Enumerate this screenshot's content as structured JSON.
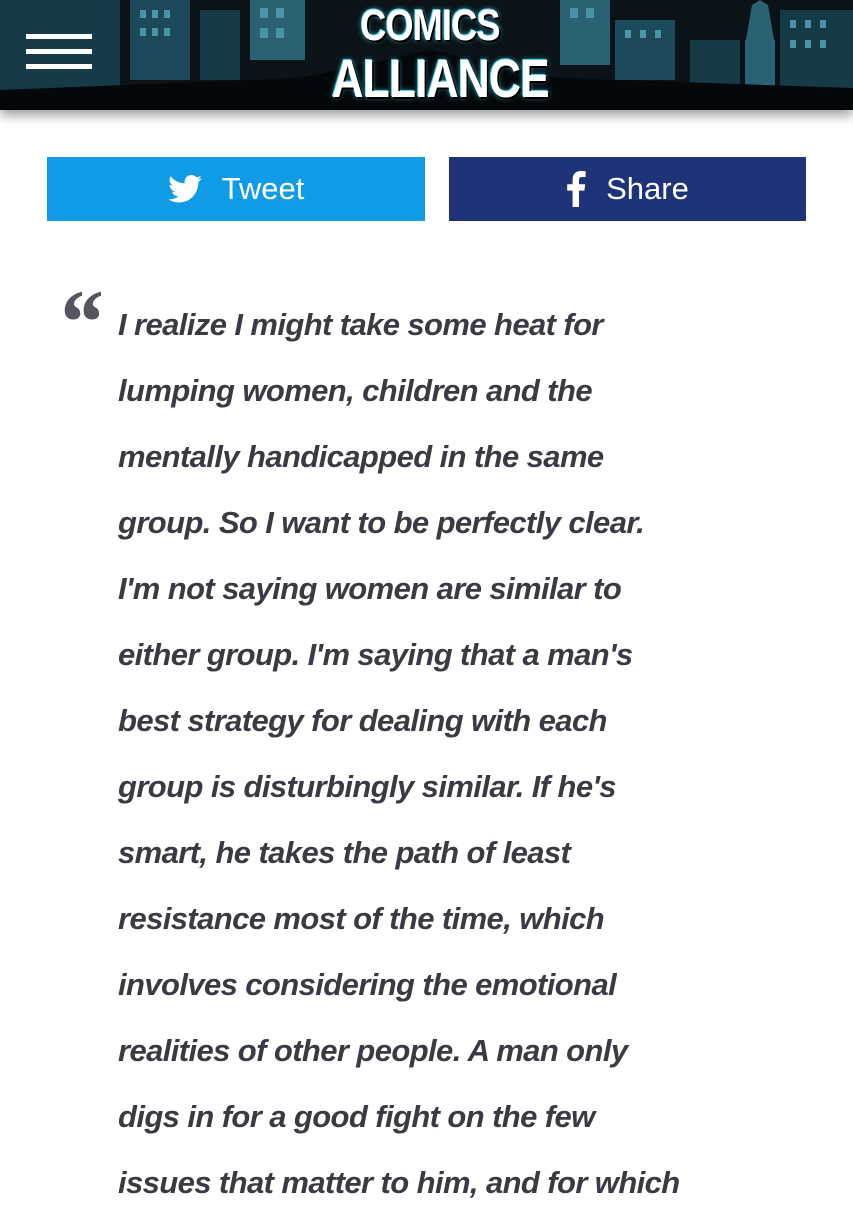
{
  "header": {
    "menu_icon": "hamburger-menu-icon",
    "logo": {
      "line1": "COMICS",
      "line2": "ALLIANCE"
    },
    "colors": {
      "background": "#0b1218",
      "skyline": "#1d4a5a",
      "accent": "#56d6ea"
    }
  },
  "share": {
    "tweet": {
      "icon": "twitter-bird-icon",
      "label": "Tweet",
      "color": "#0f9be6"
    },
    "facebook": {
      "icon": "facebook-f-icon",
      "label": "Share",
      "color": "#1e3378"
    }
  },
  "article": {
    "quote_mark": "“",
    "quote_lines": [
      "I realize I might take some heat for",
      "lumping women, children and the",
      "mentally handicapped in the same",
      "group. So I want to be perfectly clear.",
      "I'm not saying women are similar to",
      "either group. I'm saying that a man's",
      "best strategy for dealing with each",
      "group is disturbingly similar. If he's",
      "smart, he takes the path of least",
      "resistance most of the time, which",
      "involves considering the emotional",
      "realities of other people. A man only",
      "digs in for a good fight on the few",
      "issues that matter to him, and for which"
    ]
  }
}
